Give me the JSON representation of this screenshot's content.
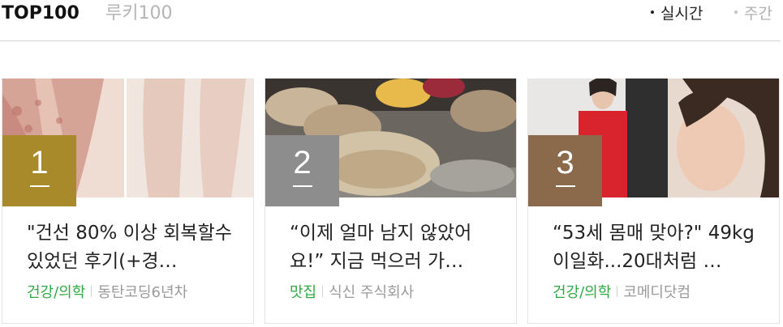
{
  "tabs": {
    "top": "TOP100",
    "rookie": "루키100"
  },
  "periods": {
    "realtime": "실시간",
    "weekly": "주간"
  },
  "accent": {
    "category": "#31a842"
  },
  "cards": [
    {
      "rank": "1",
      "rank_color": "#a88a2a",
      "title": "\"건선 80% 이상 회복할수있었던 후기(+경…",
      "category": "건강/의학",
      "source": "동탄코딩6년차"
    },
    {
      "rank": "2",
      "rank_color": "#8d8d8d",
      "title": "“이제 얼마 남지 않았어요!” 지금 먹으러 가…",
      "category": "맛집",
      "source": "식신 주식회사"
    },
    {
      "rank": "3",
      "rank_color": "#8a6a4a",
      "title": "“53세 몸매 맞아?\" 49kg 이일화...20대처럼 …",
      "category": "건강/의학",
      "source": "코메디닷컴"
    }
  ]
}
